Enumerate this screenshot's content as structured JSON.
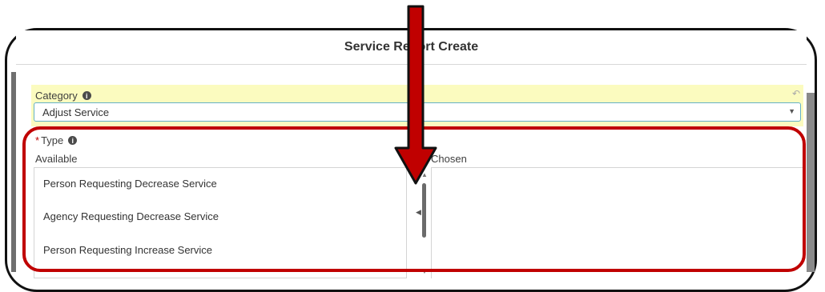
{
  "modal": {
    "title": "Service Report Create"
  },
  "category": {
    "label": "Category",
    "value": "Adjust Service",
    "info_icon": "info-icon",
    "undo_icon": "undo-icon",
    "highlight_color": "#fbfbbf",
    "focus_color": "#65b1c6"
  },
  "type": {
    "required_mark": "*",
    "label": "Type",
    "available_label": "Available",
    "chosen_label": "Chosen",
    "available_items": [
      "Person Requesting Decrease Service",
      "Agency Requesting Decrease Service",
      "Person Requesting Increase Service"
    ],
    "chosen_items": []
  },
  "annotation": {
    "color": "#c00000"
  }
}
